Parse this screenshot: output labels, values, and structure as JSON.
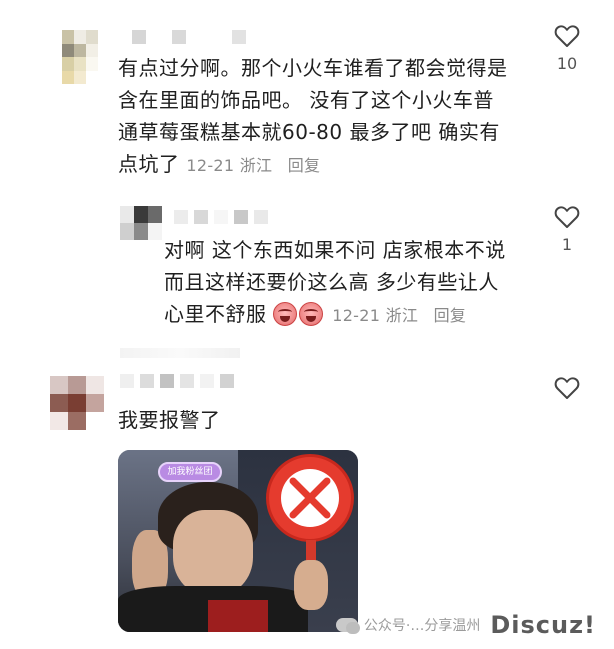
{
  "comments": [
    {
      "text_lines": [
        "有点过分啊。那个小火车谁看了都会觉得是",
        "含在里面的饰品吧。 没有了这个小火车普",
        "通草莓蛋糕基本就60-80 最多了吧 确实有",
        "点坑了"
      ],
      "date": "12-21",
      "location": "浙江",
      "reply_label": "回复",
      "likes": "10"
    },
    {
      "text_lines": [
        "对啊 这个东西如果不问 店家根本不说",
        "而且这样还要价这么高 多少有些让人",
        "心里不舒服"
      ],
      "date": "12-21",
      "location": "浙江",
      "reply_label": "回复",
      "likes": "1"
    },
    {
      "text_lines": [
        "我要报警了"
      ],
      "likes": ""
    }
  ],
  "meme": {
    "badge_text": "加我粉丝团"
  },
  "watermark": {
    "text": "公众号·…分享温州",
    "logo": "Discuz!"
  },
  "colors": {
    "text": "#1f1f1f",
    "meta": "#8a8a8a",
    "sign_red": "#e53b2e"
  }
}
